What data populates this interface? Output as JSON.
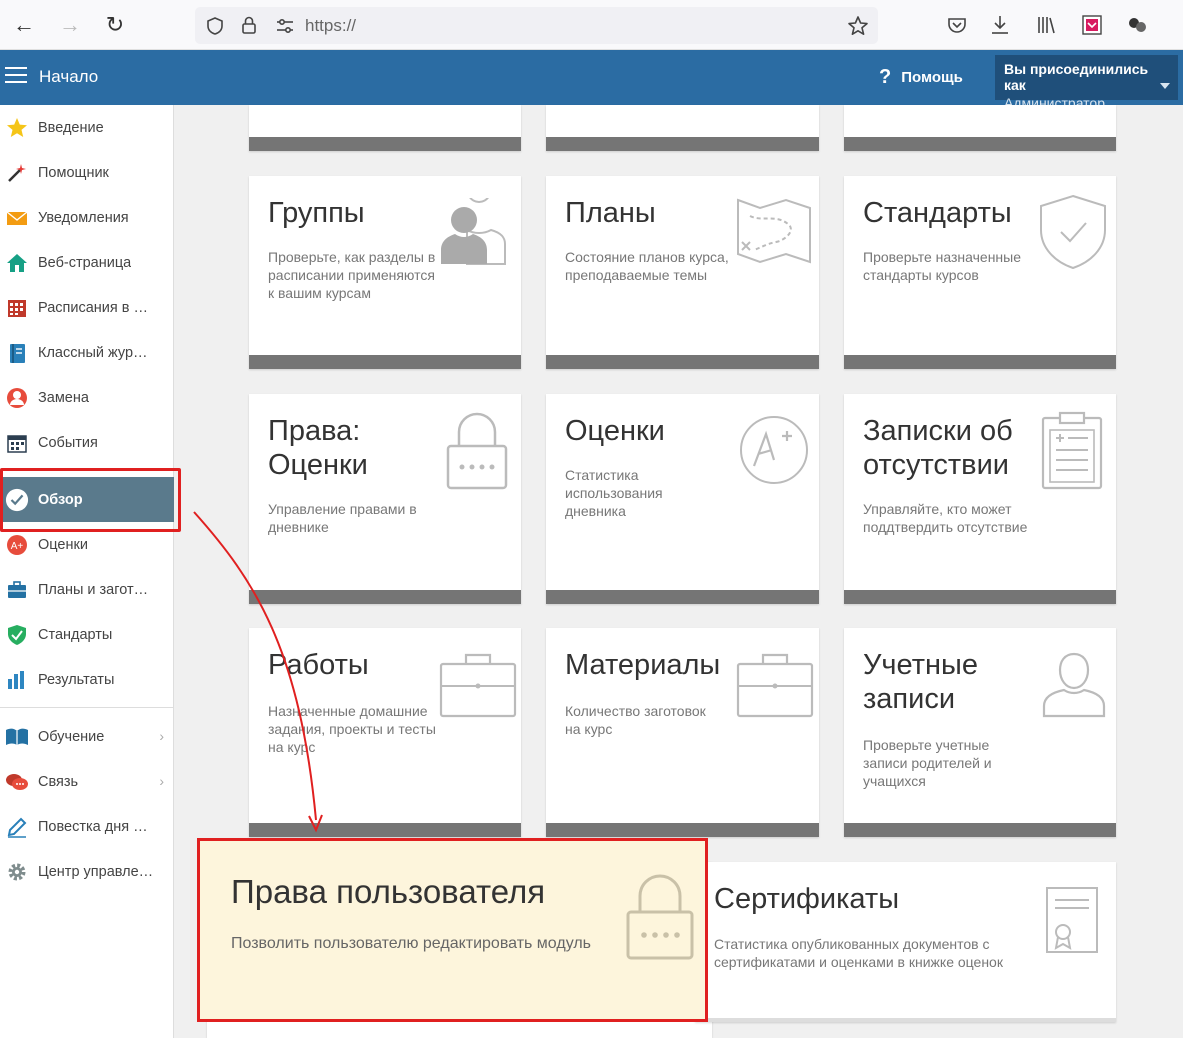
{
  "browser": {
    "url": "https://",
    "icons": [
      "back-icon",
      "forward-icon",
      "reload-icon",
      "shield-icon",
      "lock-icon",
      "permissions-icon",
      "bookmark-star-icon",
      "pocket-icon",
      "download-icon",
      "library-icon",
      "extension-icon",
      "extension-icon-2"
    ]
  },
  "header": {
    "title": "Начало",
    "help_label": "Помощь",
    "user_line1": "Вы присоединились как",
    "user_line2": "Администратор"
  },
  "sidebar": {
    "items": [
      {
        "label": "Введение",
        "icon": "star-icon"
      },
      {
        "label": "Помощник",
        "icon": "magic-wand-icon"
      },
      {
        "label": "Уведомления",
        "icon": "envelope-icon"
      },
      {
        "label": "Веб-страница",
        "icon": "home-icon"
      },
      {
        "label": "Расписания в …",
        "icon": "calendar-grid-icon"
      },
      {
        "label": "Классный жур…",
        "icon": "journal-icon"
      },
      {
        "label": "Замена",
        "icon": "person-icon"
      },
      {
        "label": "События",
        "icon": "events-calendar-icon"
      },
      {
        "label": "Обзор",
        "icon": "check-circle-icon",
        "active": true
      },
      {
        "label": "Оценки",
        "icon": "grade-icon"
      },
      {
        "label": "Планы и загот…",
        "icon": "briefcase-icon"
      },
      {
        "label": "Стандарты",
        "icon": "shield-check-icon"
      },
      {
        "label": "Результаты",
        "icon": "bar-chart-icon"
      },
      {
        "label": "Обучение",
        "icon": "book-icon",
        "chevron": true
      },
      {
        "label": "Связь",
        "icon": "chat-icon",
        "chevron": true
      },
      {
        "label": "Повестка дня …",
        "icon": "pencil-icon"
      },
      {
        "label": "Центр управле…",
        "icon": "gear-icon"
      }
    ],
    "chevron_glyph": "›"
  },
  "tiles": [
    {
      "title": "Группы",
      "desc": "Проверьте, как разделы в расписании применяются к вашим курсам",
      "icon": "users-icon"
    },
    {
      "title": "Планы",
      "desc": "Состояние планов курса, преподаваемые темы",
      "icon": "map-icon"
    },
    {
      "title": "Стандарты",
      "desc": "Проверьте назначенные стандарты курсов",
      "icon": "shield-check-icon"
    },
    {
      "title": "Права: Оценки",
      "desc": "Управление правами в дневнике",
      "icon": "padlock-icon"
    },
    {
      "title": "Оценки",
      "desc": "Статистика использования дневника",
      "icon": "grade-a-plus-icon"
    },
    {
      "title": "Записки об отсутствии",
      "desc": "Управляйте, кто может поддтвердить отсутствие",
      "icon": "clipboard-icon"
    },
    {
      "title": "Работы",
      "desc": "Назначенные домашние задания, проекты и тесты на курс",
      "icon": "briefcase-icon"
    },
    {
      "title": "Материалы",
      "desc": "Количество заготовок на курс",
      "icon": "briefcase-icon"
    },
    {
      "title": "Учетные записи",
      "desc": "Проверьте учетные записи родителей и учащихся",
      "icon": "user-icon"
    },
    {
      "title": "Сертификаты",
      "desc": "Статистика опубликованных документов с сертификатами и оценками в книжке оценок",
      "icon": "certificate-icon"
    }
  ],
  "highlight": {
    "title": "Права пользователя",
    "desc": "Позволить пользователю редактировать модуль",
    "icon": "padlock-icon"
  },
  "colors": {
    "header_bg": "#2b6ca3",
    "active_item_bg": "#5a7a8c",
    "highlight_border": "#e02020",
    "highlight_bg": "#fdf5dc",
    "tile_bar": "#757575"
  }
}
